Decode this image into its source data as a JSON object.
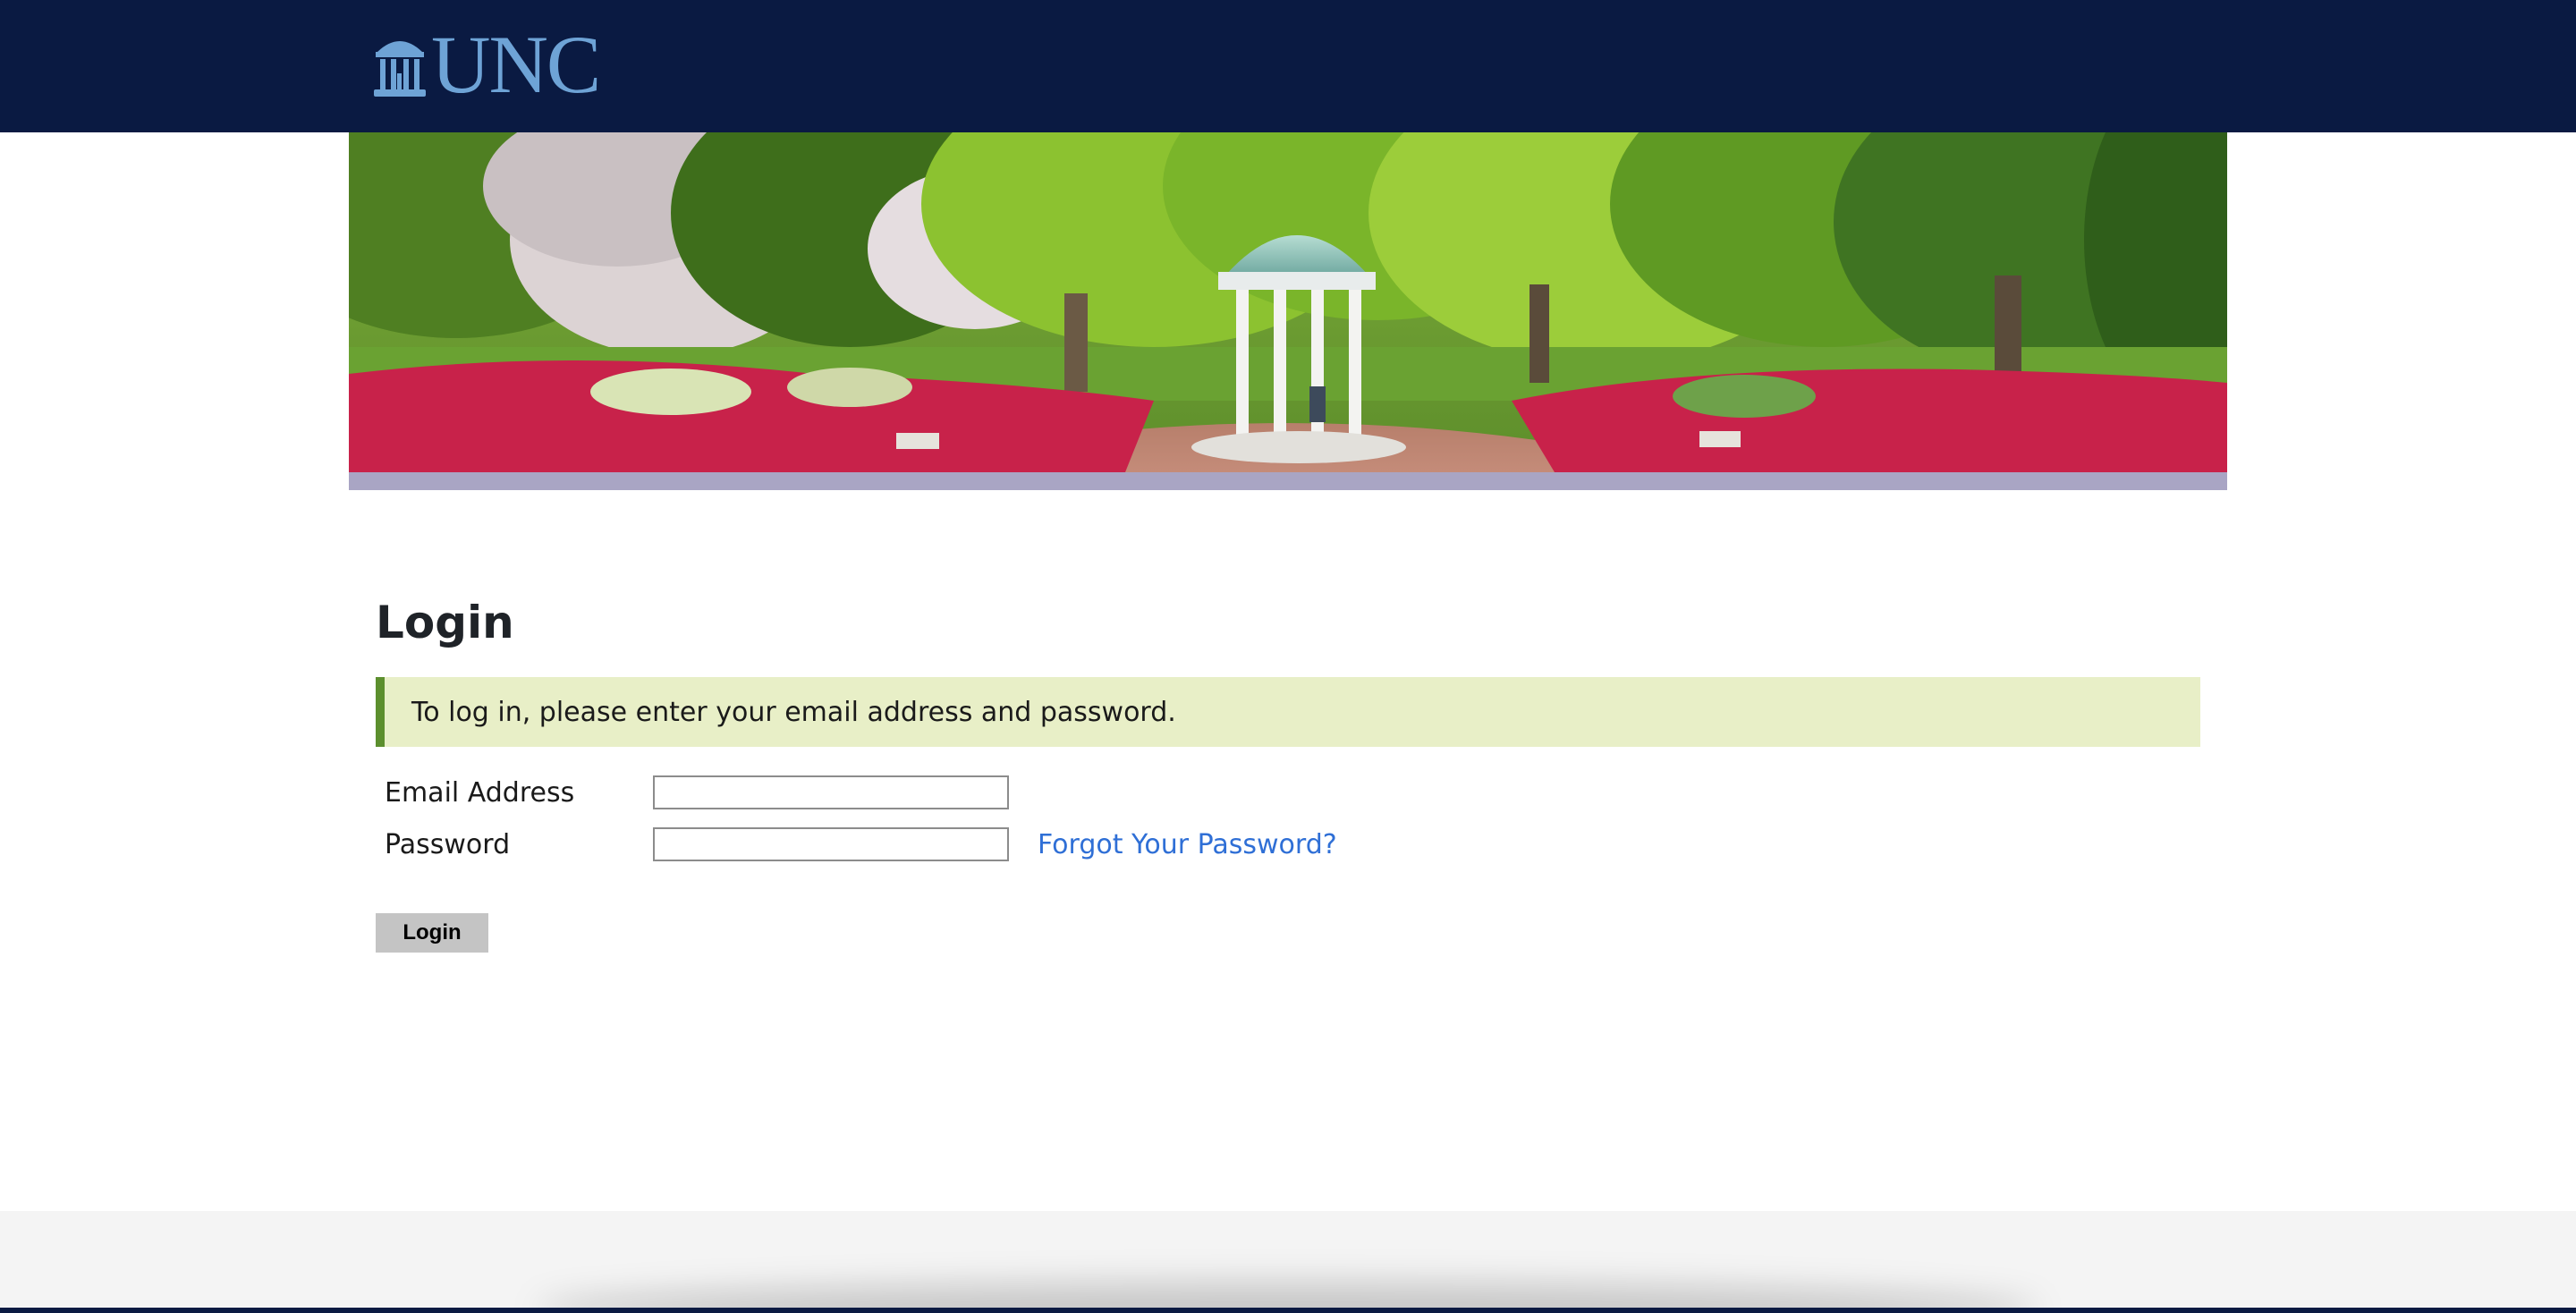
{
  "header": {
    "logo_text": "UNC",
    "background_color": "#0a1a42",
    "logo_color": "#6ea3d6"
  },
  "main": {
    "title": "Login",
    "info_message": "To log in, please enter your email address and password.",
    "form": {
      "email_label": "Email Address",
      "email_value": "",
      "password_label": "Password",
      "password_value": "",
      "forgot_link": "Forgot Your Password?",
      "submit_label": "Login"
    }
  },
  "colors": {
    "info_background": "#e8efc7",
    "info_accent": "#5c8f2e",
    "link": "#2f6fd6",
    "button": "#c4c4c4"
  }
}
